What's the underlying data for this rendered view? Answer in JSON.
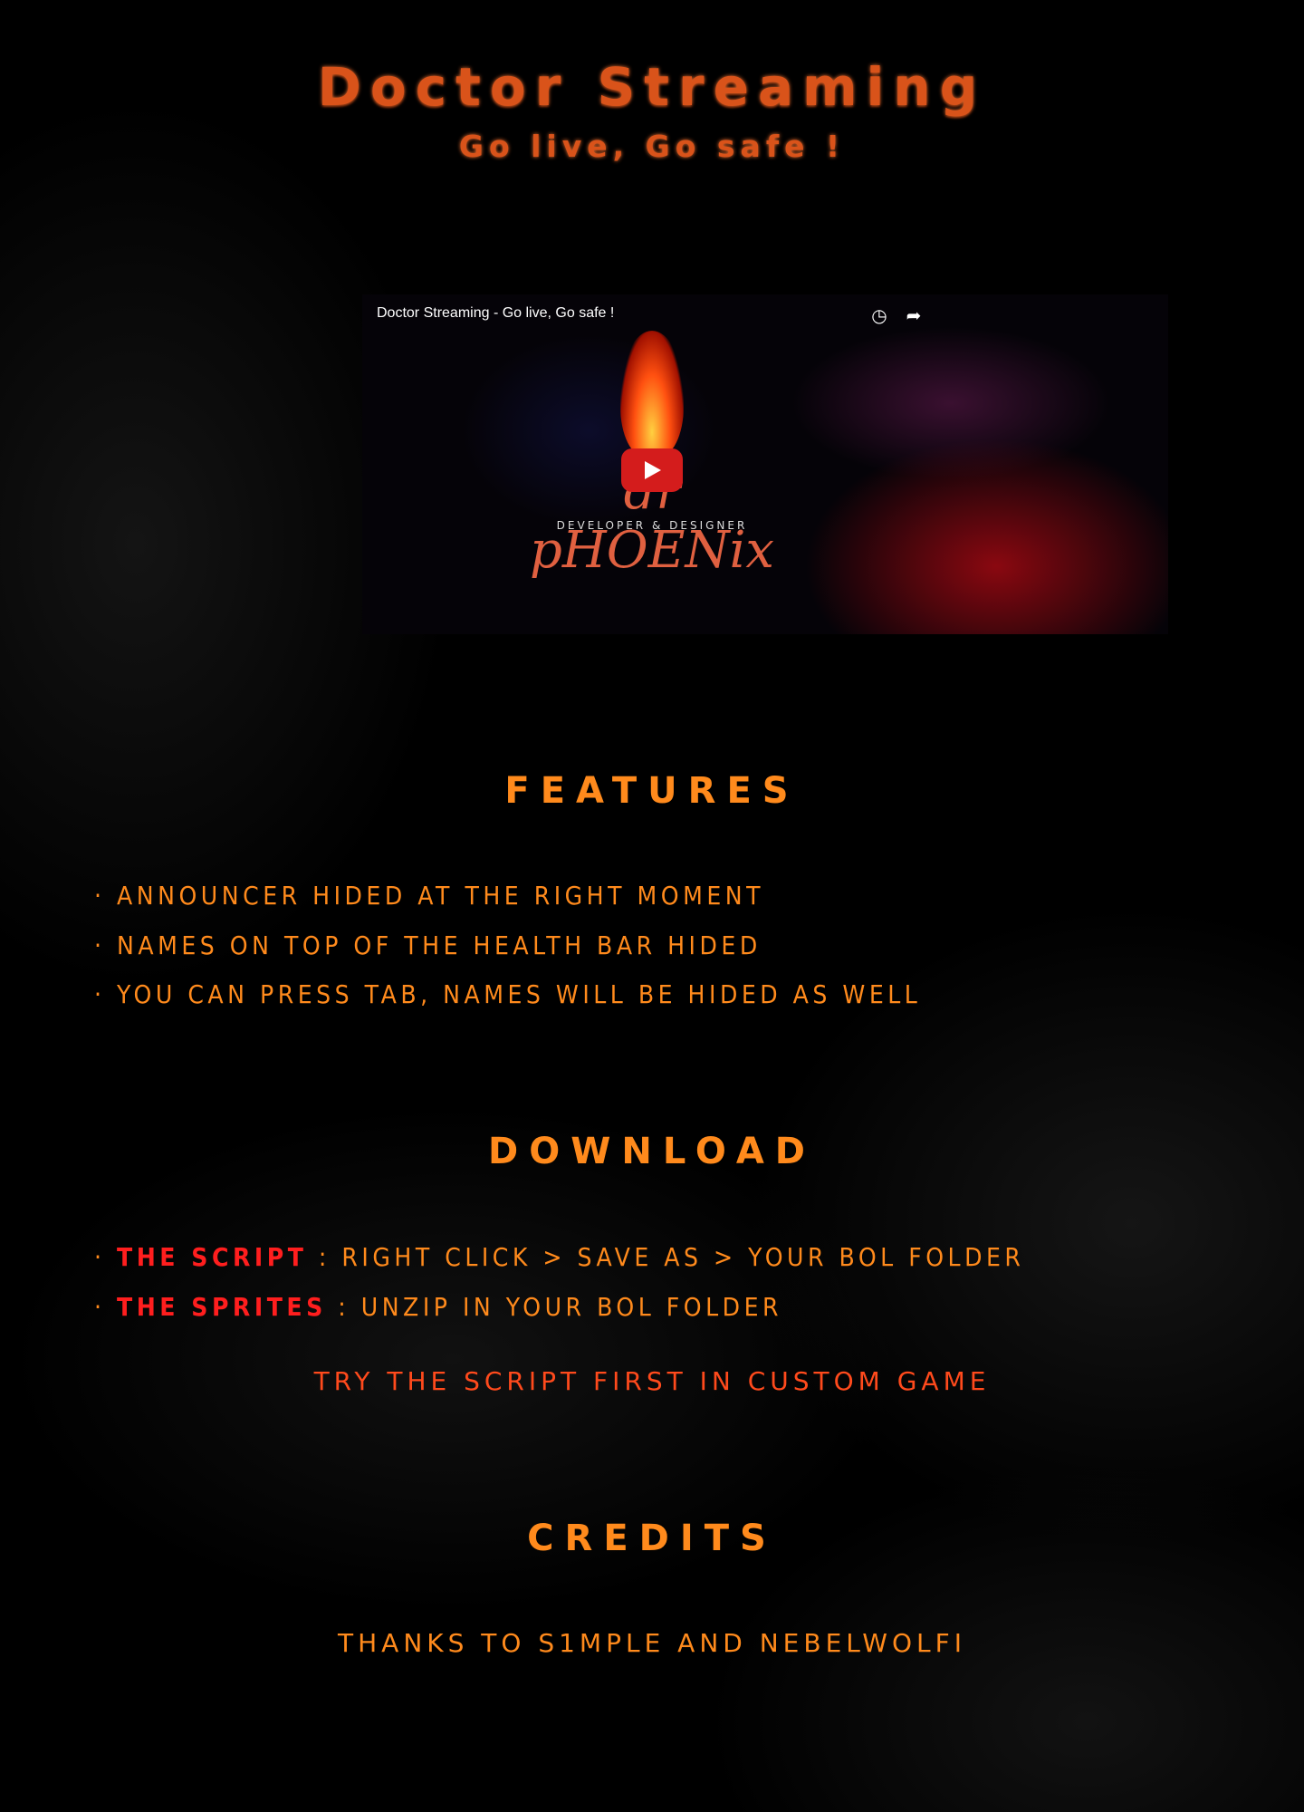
{
  "header": {
    "title": "Doctor Streaming",
    "subtitle": "Go live, Go safe !"
  },
  "video": {
    "title": "Doctor Streaming - Go live, Go safe !",
    "brand": "dr pHOENix",
    "brand_sub": "DEVELOPER & DESIGNER"
  },
  "features": {
    "heading": "FEATURES",
    "items": [
      "· ANNOUNCER HIDED AT THE RIGHT MOMENT",
      "· NAMES ON TOP OF THE HEALTH BAR HIDED",
      "· YOU CAN PRESS TAB, NAMES WILL BE HIDED AS WELL"
    ]
  },
  "download": {
    "heading": "DOWNLOAD",
    "items": [
      {
        "bullet": "·",
        "link": "THE SCRIPT",
        "text": " : RIGHT CLICK > SAVE AS > YOUR BOL FOLDER"
      },
      {
        "bullet": "·",
        "link": "THE SPRITES",
        "text": " : UNZIP IN YOUR BOL FOLDER"
      }
    ],
    "note": "TRY THE SCRIPT FIRST IN CUSTOM GAME"
  },
  "credits": {
    "heading": "CREDITS",
    "text": "THANKS TO S1MPLE AND NEBELWOLFI"
  }
}
